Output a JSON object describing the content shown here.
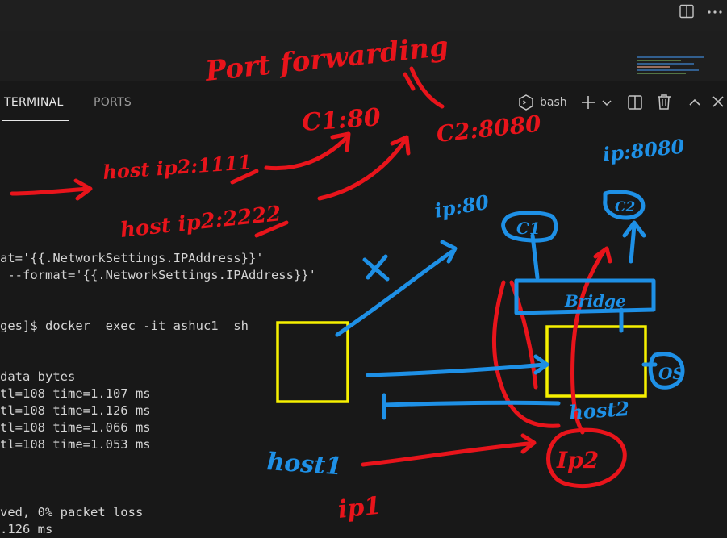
{
  "panel": {
    "tabs": [
      {
        "label": "TERMINAL",
        "active": true
      },
      {
        "label": "PORTS",
        "active": false
      }
    ],
    "shell_label": "bash"
  },
  "terminal": {
    "lines": [
      "",
      "",
      "",
      "",
      "at='{{.NetworkSettings.IPAddress}}'",
      " --format='{{.NetworkSettings.IPAddress}}'",
      "",
      "",
      "ges]$ docker  exec -it ashuc1  sh",
      "",
      "",
      "data bytes",
      "tl=108 time=1.107 ms",
      "tl=108 time=1.126 ms",
      "tl=108 time=1.066 ms",
      "tl=108 time=1.053 ms",
      "",
      "",
      "",
      "ved, 0% packet loss",
      ".126 ms"
    ]
  },
  "annotations": {
    "port_forwarding": "Port forwarding",
    "c1_port": "C1:80",
    "c2_port": "C2:8080",
    "host_ip_1111": "host ip2:1111",
    "host_ip_2222": "host ip2:2222",
    "ip_80": "ip:80",
    "ip_8080": "ip:8080",
    "c1_label": "C1",
    "c2_label": "C2",
    "x_mark": "X",
    "bridge_label": "Bridge",
    "os_label": "OS",
    "host2_label": "host2",
    "host1_label": "host1",
    "ip2_label": "Ip2",
    "ip1_label": "ip1"
  },
  "colors": {
    "ink_red": "#e8141b",
    "ink_blue": "#1e90e6",
    "box_yellow": "#f6f000"
  }
}
